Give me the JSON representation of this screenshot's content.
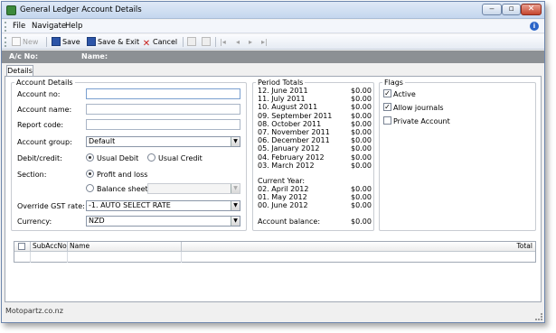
{
  "window": {
    "title": "General Ledger Account Details"
  },
  "menu": {
    "items": [
      "File",
      "Navigate",
      "Help"
    ]
  },
  "toolbar": {
    "new_label": "New",
    "save_label": "Save",
    "save_exit_label": "Save & Exit",
    "cancel_label": "Cancel"
  },
  "header": {
    "acno_label": "A/c No:",
    "name_label": "Name:"
  },
  "tabs": [
    "Details"
  ],
  "account_details": {
    "legend": "Account Details",
    "account_no_label": "Account no:",
    "account_no_value": "",
    "account_name_label": "Account name:",
    "account_name_value": "",
    "report_code_label": "Report code:",
    "report_code_value": "",
    "account_group_label": "Account group:",
    "account_group_value": "Default",
    "debit_credit_label": "Debit/credit:",
    "usual_debit": "Usual Debit",
    "usual_credit": "Usual Credit",
    "section_label": "Section:",
    "profit_loss": "Profit and loss",
    "balance_sheet": "Balance sheet",
    "balance_sheet_value": "",
    "override_gst_label": "Override GST rate:",
    "override_gst_value": "-1. AUTO SELECT RATE",
    "currency_label": "Currency:",
    "currency_value": "NZD"
  },
  "period_totals": {
    "legend": "Period Totals",
    "rows": [
      {
        "period": "12. June 2011",
        "amount": "$0.00"
      },
      {
        "period": "11. July 2011",
        "amount": "$0.00"
      },
      {
        "period": "10. August 2011",
        "amount": "$0.00"
      },
      {
        "period": "09. September 2011",
        "amount": "$0.00"
      },
      {
        "period": "08. October 2011",
        "amount": "$0.00"
      },
      {
        "period": "07. November 2011",
        "amount": "$0.00"
      },
      {
        "period": "06. December 2011",
        "amount": "$0.00"
      },
      {
        "period": "05. January 2012",
        "amount": "$0.00"
      },
      {
        "period": "04. February 2012",
        "amount": "$0.00"
      },
      {
        "period": "03. March 2012",
        "amount": "$0.00"
      }
    ],
    "current_year_label": "Current Year:",
    "current_rows": [
      {
        "period": "02. April 2012",
        "amount": "$0.00"
      },
      {
        "period": "01. May 2012",
        "amount": "$0.00"
      },
      {
        "period": "00. June 2012",
        "amount": "$0.00"
      }
    ],
    "balance_label": "Account balance:",
    "balance_value": "$0.00"
  },
  "flags": {
    "legend": "Flags",
    "active": "Active",
    "allow_journals": "Allow journals",
    "private_account": "Private Account",
    "active_checked": true,
    "allow_journals_checked": true,
    "private_account_checked": false
  },
  "grid": {
    "columns": [
      "",
      "SubAccNo",
      "Name",
      "Total"
    ]
  },
  "status": {
    "text": "Motopartz.co.nz"
  }
}
